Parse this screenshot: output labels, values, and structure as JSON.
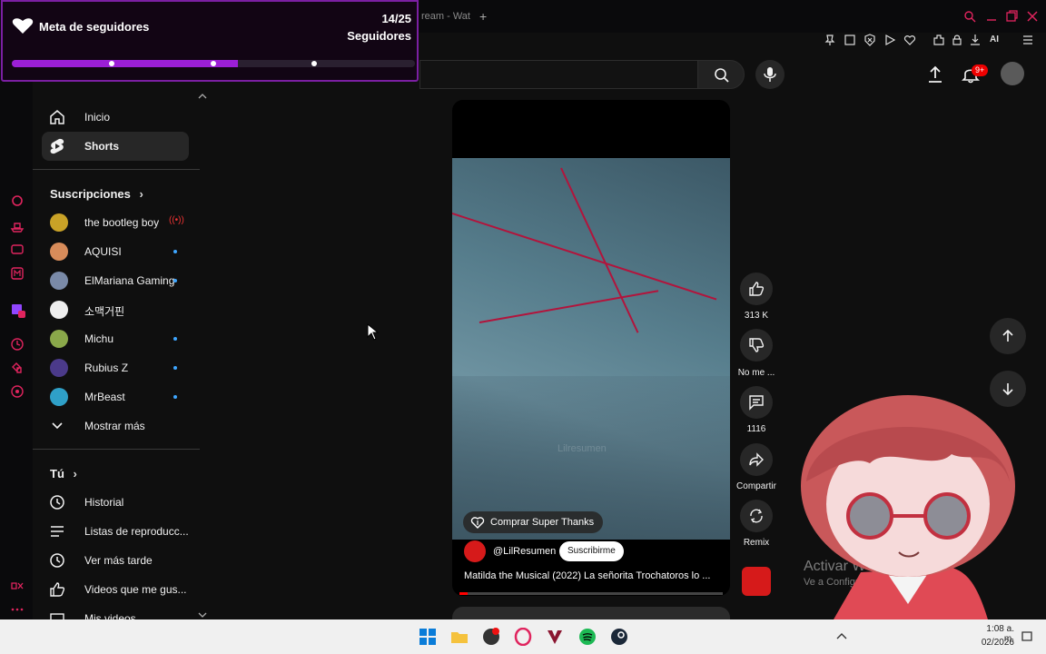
{
  "goal_widget": {
    "title": "Meta de seguidores",
    "count": "14/25",
    "subtitle": "Seguidores",
    "progress": 0.56,
    "accent": "#9c1fd6"
  },
  "browser": {
    "tab_title": "ream - Wat",
    "new_tab": "+",
    "extension_ai": "AI"
  },
  "header": {
    "notifications_badge": "9+"
  },
  "sidebar": {
    "primary": [
      {
        "label": "Inicio",
        "icon": "home-icon"
      },
      {
        "label": "Shorts",
        "icon": "shorts-icon",
        "active": true
      }
    ],
    "subscriptions_title": "Suscripciones",
    "subscriptions": [
      {
        "label": "the bootleg boy",
        "status": "live"
      },
      {
        "label": "AQUISI",
        "status": "new"
      },
      {
        "label": "ElMariana Gaming",
        "status": "new"
      },
      {
        "label": "소맥거핀",
        "status": ""
      },
      {
        "label": "Michu",
        "status": "new"
      },
      {
        "label": "Rubius Z",
        "status": "new"
      },
      {
        "label": "MrBeast",
        "status": "new"
      }
    ],
    "show_more": "Mostrar más",
    "you_title": "Tú",
    "you_items": [
      {
        "label": "Historial",
        "icon": "history-icon"
      },
      {
        "label": "Listas de reproducc...",
        "icon": "playlist-icon"
      },
      {
        "label": "Ver más tarde",
        "icon": "clock-icon"
      },
      {
        "label": "Videos que me gus...",
        "icon": "thumbs-up-icon"
      },
      {
        "label": "Mis videos",
        "icon": "video-icon"
      }
    ]
  },
  "short": {
    "watermark": "Lilresumen",
    "super_thanks": "Comprar Super Thanks",
    "channel": "@LilResumen",
    "subscribe": "Suscribirme",
    "title": "Matilda the Musical (2022) La señorita Trochatoros lo ...",
    "progress": 0.03
  },
  "actions": {
    "likes": "313 K",
    "dislike": "No me ...",
    "comments": "1116",
    "share": "Compartir",
    "remix": "Remix"
  },
  "watermark_windows": {
    "title": "Activar W",
    "subtitle": "Ve a Configur                         Windows."
  },
  "taskbar": {
    "time": "1:08 a. m.",
    "date": "02/2026"
  }
}
